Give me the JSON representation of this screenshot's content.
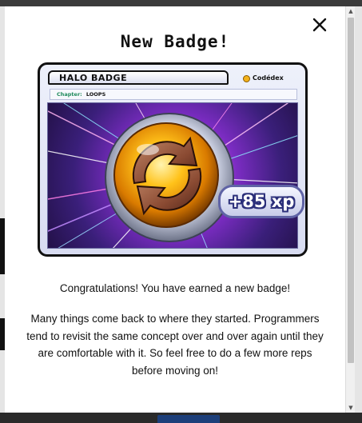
{
  "modal": {
    "title": "New Badge!",
    "close_icon": "close-icon",
    "congrats_text": "Congratulations! You have earned a new badge!",
    "description": "Many things come back to where they started. Programmers tend to revisit the same concept over and over again until they are comfortable with it. So feel free to do a few more reps before moving on!"
  },
  "badge": {
    "name": "HALO BADGE",
    "brand": "Codédex",
    "chapter_label": "Chapter:",
    "chapter_value": "LOOPS",
    "xp": "+85 xp",
    "emblem_icon": "loop-arrows-icon"
  },
  "colors": {
    "modal_bg": "#ffffff",
    "overlay": "#6e6e6e",
    "xp_outline": "#2b2f7a",
    "chapter_label": "#1f8a5c"
  }
}
